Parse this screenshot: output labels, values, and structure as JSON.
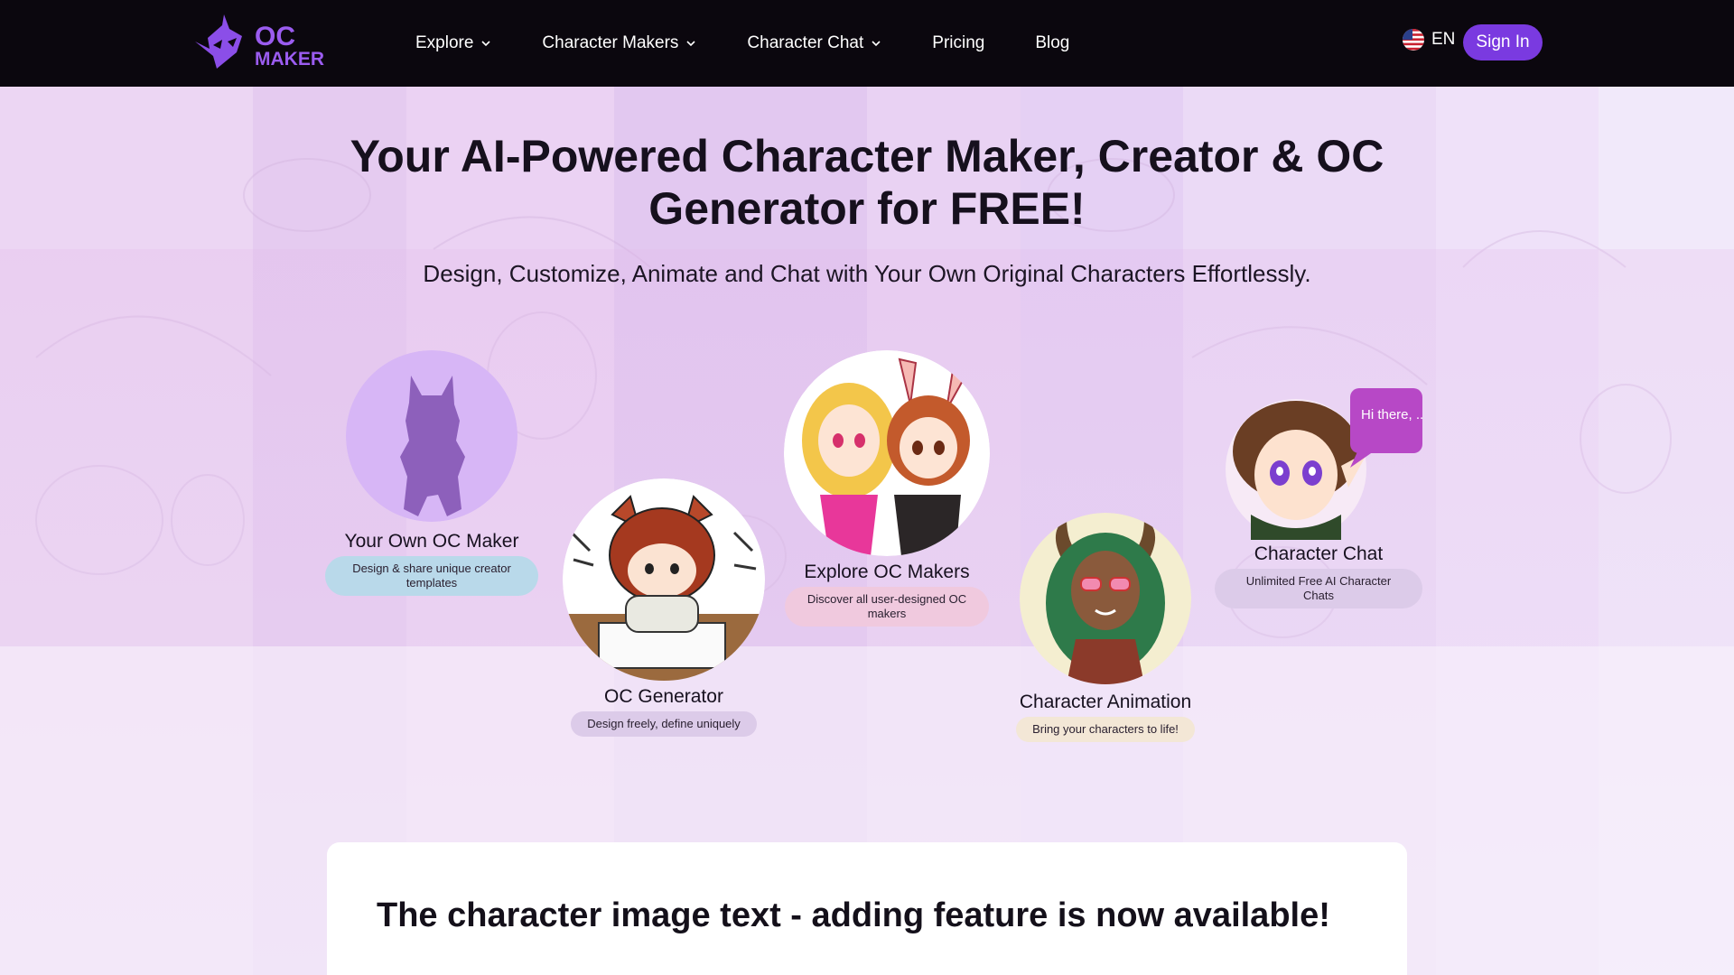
{
  "brand": {
    "logo_line1": "OC",
    "logo_line2": "MAKER",
    "logo_color": "#8b4ee8"
  },
  "nav": {
    "items": [
      {
        "label": "Explore",
        "has_dropdown": true
      },
      {
        "label": "Character Makers",
        "has_dropdown": true
      },
      {
        "label": "Character Chat",
        "has_dropdown": true
      },
      {
        "label": "Pricing",
        "has_dropdown": false
      },
      {
        "label": "Blog",
        "has_dropdown": false
      }
    ],
    "language": {
      "label": "EN",
      "icon": "us-flag-icon"
    },
    "signin_label": "Sign In",
    "accent_color": "#7a3ae0"
  },
  "hero": {
    "title": "Your AI-Powered Character Maker, Creator & OC Generator for FREE!",
    "subtitle": "Design, Customize, Animate and Chat with Your Own Original Characters Effortlessly."
  },
  "features": [
    {
      "title": "Your Own OC Maker",
      "description": "Design & share unique creator templates",
      "pill_color": "#b9d9ea"
    },
    {
      "title": "OC Generator",
      "description": "Design freely, define uniquely",
      "pill_color": "#dccbe9"
    },
    {
      "title": "Explore OC Makers",
      "description": "Discover all user-designed OC makers",
      "pill_color": "#f0c9de"
    },
    {
      "title": "Character Animation",
      "description": "Bring your characters to life!",
      "pill_color": "#f3e7d6"
    },
    {
      "title": "Character Chat",
      "description": "Unlimited Free AI Character Chats",
      "pill_color": "#dccbe9",
      "bubble_text": "Hi there, ......"
    }
  ],
  "announcement": {
    "title": "The character image text - adding feature is now available!"
  }
}
